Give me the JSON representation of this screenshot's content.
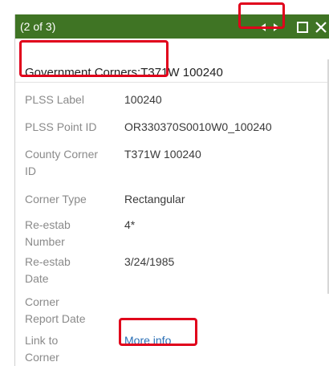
{
  "header": {
    "counter": "(2 of 3)",
    "icons": {
      "prev": "previous-arrow-icon",
      "next": "next-arrow-icon",
      "maximize": "maximize-icon",
      "close": "close-icon"
    },
    "colors": {
      "bar": "#3f7424",
      "highlight": "#e0001b"
    }
  },
  "title": {
    "prefix": "Government Corners:",
    "value": "T371W 100240"
  },
  "fields": [
    {
      "label": "PLSS Label",
      "value": "100240"
    },
    {
      "label": "PLSS Point ID",
      "value": "OR330370S0010W0_100240"
    },
    {
      "label": "County Corner ID",
      "value": "T371W 100240"
    },
    {
      "label": "Corner Type",
      "value": "Rectangular"
    },
    {
      "label": "Re-estab Number",
      "value": "4*"
    },
    {
      "label": "Re-estab Date",
      "value": "3/24/1985"
    },
    {
      "label": "Corner Report Date",
      "value": ""
    },
    {
      "label": "Link to Corner Document",
      "value": "More info"
    }
  ]
}
